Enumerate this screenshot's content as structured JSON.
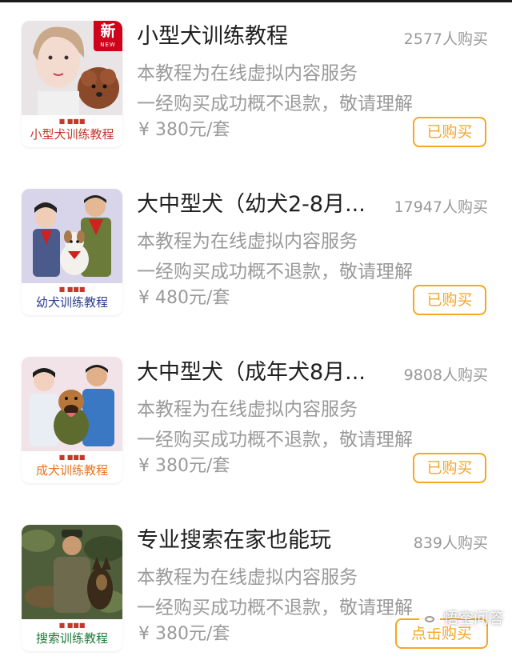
{
  "items": [
    {
      "title": "小型犬训练教程",
      "buyers": "2577人购买",
      "desc1": "本教程为在线虚拟内容服务",
      "desc2": "一经购买成功概不退款，敬请理解",
      "price": "¥ 380元/套",
      "button": "已购买",
      "thumb_caption": "小型犬训练教程",
      "thumb_caption_color": "#c0392b",
      "badge": {
        "zh": "新",
        "en": "NEW"
      }
    },
    {
      "title": "大中型犬（幼犬2-8月...",
      "buyers": "17947人购买",
      "desc1": "本教程为在线虚拟内容服务",
      "desc2": "一经购买成功概不退款，敬请理解",
      "price": "¥ 480元/套",
      "button": "已购买",
      "thumb_caption": "幼犬训练教程",
      "thumb_caption_color": "#2c3e8c"
    },
    {
      "title": "大中型犬（成年犬8月...",
      "buyers": "9808人购买",
      "desc1": "本教程为在线虚拟内容服务",
      "desc2": "一经购买成功概不退款，敬请理解",
      "price": "¥ 380元/套",
      "button": "已购买",
      "thumb_caption": "成犬训练教程",
      "thumb_caption_color": "#e8731c"
    },
    {
      "title": "专业搜索在家也能玩",
      "buyers": "839人购买",
      "desc1": "本教程为在线虚拟内容服务",
      "desc2": "一经购买成功概不退款，敬请理解",
      "price": "¥ 380元/套",
      "button": "点击购买",
      "thumb_caption": "搜索训练教程",
      "thumb_caption_color": "#1e7a3a"
    }
  ],
  "watermark": "悟空问答",
  "accent_color": "#f5a623"
}
